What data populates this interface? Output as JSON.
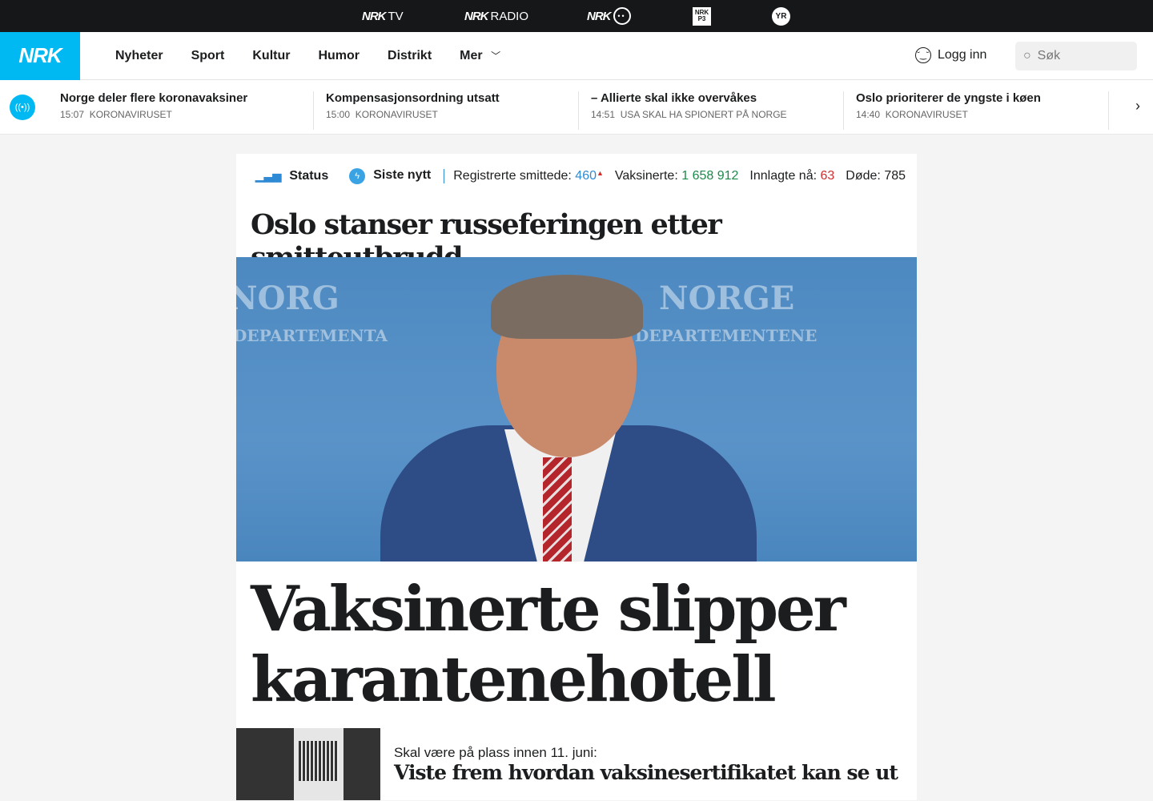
{
  "topbar": {
    "services": [
      {
        "brand": "NRK",
        "label": "TV"
      },
      {
        "brand": "NRK",
        "label": "RADIO"
      },
      {
        "brand": "NRK",
        "label": "Super"
      },
      {
        "brand": "NRK P3",
        "label": "P3"
      },
      {
        "brand": "YR",
        "label": "YR"
      }
    ]
  },
  "nav": {
    "logo": "NRK",
    "items": [
      "Nyheter",
      "Sport",
      "Kultur",
      "Humor",
      "Distrikt",
      "Mer"
    ],
    "login": "Logg inn",
    "search_placeholder": "Søk"
  },
  "ticker": [
    {
      "title": "Norge deler flere koronavaksiner",
      "time": "15:07",
      "tag": "KORONAVIRUSET"
    },
    {
      "title": "Kompensasjonsordning utsatt",
      "time": "15:00",
      "tag": "KORONAVIRUSET"
    },
    {
      "title": "– Allierte skal ikke overvåkes",
      "time": "14:51",
      "tag": "USA SKAL HA SPIONERT PÅ NORGE"
    },
    {
      "title": "Oslo prioriterer de yngste i køen",
      "time": "14:40",
      "tag": "KORONAVIRUSET"
    }
  ],
  "status": {
    "status_label": "Status",
    "latest_label": "Siste nytt",
    "infected_label": "Registrerte smittede:",
    "infected": "460",
    "vaccinated_label": "Vaksinerte:",
    "vaccinated": "1 658 912",
    "hospital_label": "Innlagte nå:",
    "hospital": "63",
    "deaths_label": "Døde:",
    "deaths": "785"
  },
  "articles": {
    "top": "Oslo stanser russeferingen etter smitteutbrudd",
    "main": "Vaksinerte slipper karantenehotell",
    "photo_text": [
      "NORGE",
      "DEPARTEMENTENE",
      "DEPARTEMENTA",
      "NORG"
    ],
    "sub_kicker": "Skal være på plass innen 11. juni:",
    "sub_title": "Viste frem hvordan vaksinesertifikatet kan se ut"
  },
  "colors": {
    "brand": "#00b9f2",
    "infected": "#2f8ad6",
    "vaccinated": "#1b8a4a",
    "hospital": "#d12e2e"
  }
}
